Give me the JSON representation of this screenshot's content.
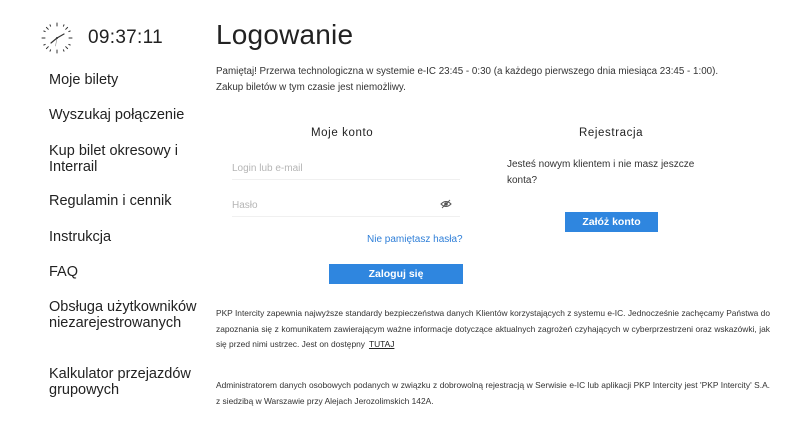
{
  "clock": {
    "time": "09:37:11",
    "icon": "clock-icon"
  },
  "sidebar": {
    "items": [
      {
        "label": "Moje bilety"
      },
      {
        "label": "Wyszukaj połączenie"
      },
      {
        "label": "Kup bilet okresowy i Interrail"
      },
      {
        "label": "Regulamin i cennik"
      },
      {
        "label": "Instrukcja"
      },
      {
        "label": "FAQ"
      },
      {
        "label": "Obsługa użytkowników niezarejestrowanych"
      },
      {
        "label": "Kalkulator przejazdów grupowych"
      }
    ]
  },
  "main": {
    "title": "Logowanie",
    "notice_line1": "Pamiętaj! Przerwa technologiczna w systemie e-IC 23:45 - 0:30 (a każdego pierwszego dnia miesiąca 23:45 - 1:00).",
    "notice_line2": "Zakup biletów w tym czasie jest niemożliwy."
  },
  "login": {
    "title": "Moje konto",
    "login_placeholder": "Login lub e-mail",
    "password_placeholder": "Hasło",
    "forgot_link": "Nie pamiętasz hasła?",
    "submit_label": "Zaloguj się",
    "password_toggle_icon": "eye-icon"
  },
  "register": {
    "title": "Rejestracja",
    "text": "Jesteś nowym klientem i nie masz jeszcze konta?",
    "button_label": "Załóż konto"
  },
  "footer": {
    "privacy_text": "PKP Intercity zapewnia najwyższe standardy bezpieczeństwa danych Klientów korzystających z systemu e-IC. Jednocześnie zachęcamy Państwa do zapoznania się z komunikatem zawierającym ważne informacje dotyczące aktualnych zagrożeń czyhających w cyberprzestrzeni oraz wskazówki, jak się przed nimi ustrzec. Jest on dostępny",
    "privacy_link": "TUTAJ",
    "admin_text": "Administratorem danych osobowych podanych w związku z dobrowolną rejestracją w Serwisie e-IC lub aplikacji PKP Intercity jest 'PKP Intercity' S.A. z siedzibą w Warszawie przy Alejach Jerozolimskich 142A."
  },
  "colors": {
    "accent": "#2f86df",
    "link": "#2f7fd8",
    "text": "#222222"
  }
}
